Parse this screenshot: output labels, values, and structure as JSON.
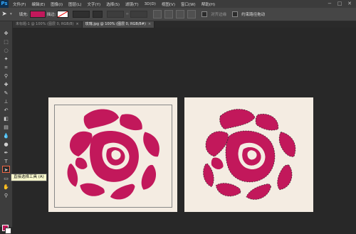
{
  "app": {
    "logo": "Ps"
  },
  "menu": [
    "文件(F)",
    "编辑(E)",
    "图像(I)",
    "图层(L)",
    "文字(Y)",
    "选择(S)",
    "滤镜(T)",
    "3D(D)",
    "视图(V)",
    "窗口(W)",
    "帮助(H)"
  ],
  "window_controls": {
    "minimize": "−",
    "maximize": "□",
    "close": "✕"
  },
  "options": {
    "fill_label": "填充:",
    "fill_color": "#c2185b",
    "stroke_label": "描边:",
    "align_edges_label": "对齐边缘",
    "constrain_path_label": "约束路径拖动"
  },
  "tabs": [
    {
      "label": "未标题-1 @ 100% (图层 0, RGB/8)",
      "active": false
    },
    {
      "label": "玫瑰.jpg @ 100% (图层 0, RGB/8#)",
      "active": true
    }
  ],
  "tooltip": {
    "text": "直接选择工具 (A)"
  },
  "colors": {
    "foreground": "#c2185b",
    "background": "#ffffff",
    "rose": "#c2185b",
    "canvas": "#f4ece2"
  },
  "icons": [
    "move-icon",
    "marquee-icon",
    "lasso-icon",
    "magic-wand-icon",
    "crop-icon",
    "eyedropper-icon",
    "spot-heal-icon",
    "brush-icon",
    "clone-stamp-icon",
    "history-brush-icon",
    "eraser-icon",
    "gradient-icon",
    "blur-icon",
    "dodge-icon",
    "pen-icon",
    "type-icon",
    "direct-selection-icon",
    "shape-icon",
    "hand-icon",
    "zoom-icon"
  ]
}
